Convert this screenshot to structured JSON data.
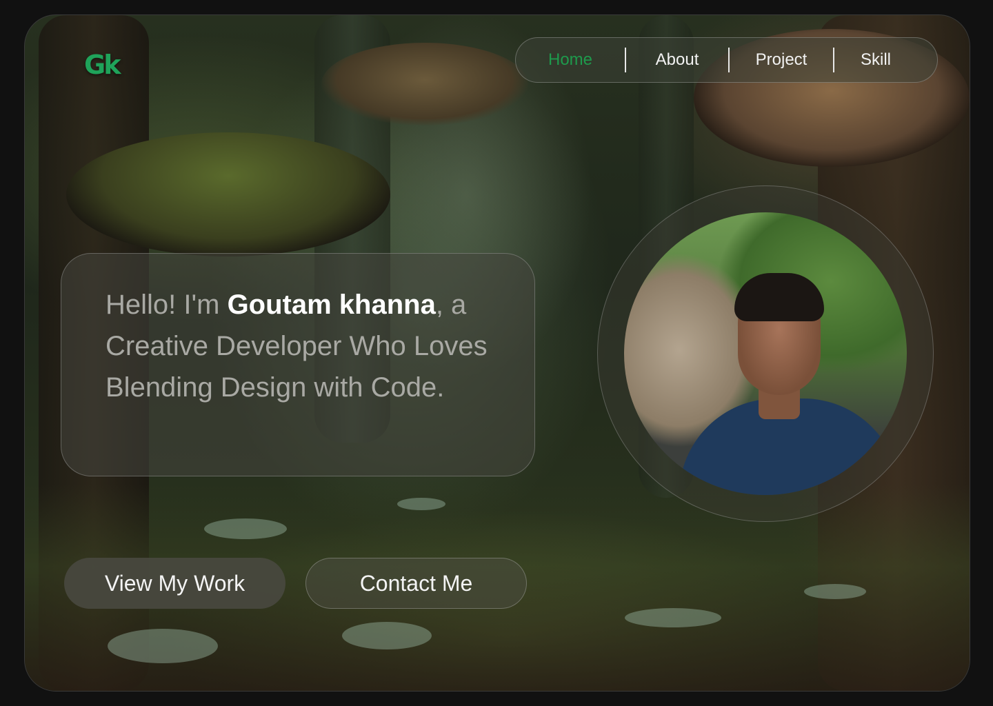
{
  "logo": {
    "text": "Gk",
    "color": "#1fa35a"
  },
  "nav": {
    "items": [
      {
        "label": "Home",
        "active": true
      },
      {
        "label": "About",
        "active": false
      },
      {
        "label": "Project",
        "active": false
      },
      {
        "label": "Skill",
        "active": false
      }
    ]
  },
  "hero": {
    "greeting": "Hello! I'm ",
    "name": "Goutam khanna",
    "tagline": ", a Creative Developer Who Loves Blending Design with Code."
  },
  "buttons": {
    "work_label": "View My Work",
    "contact_label": "Contact Me"
  },
  "colors": {
    "accent": "#1e9a4c",
    "background": "#111111"
  }
}
